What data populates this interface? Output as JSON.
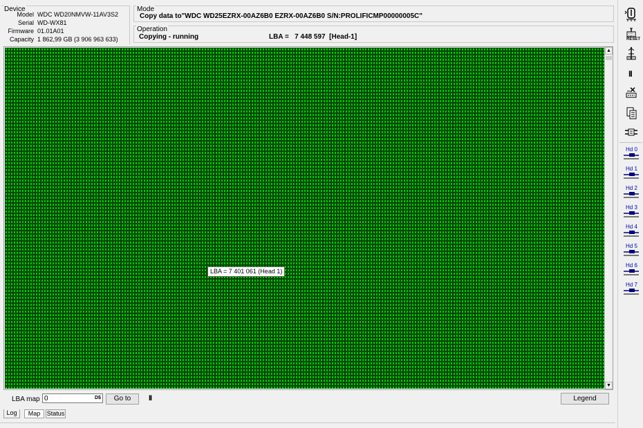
{
  "device": {
    "title": "Device",
    "rows": [
      {
        "key": "Model",
        "value": "WDC WD20NMVW-11AV3S2"
      },
      {
        "key": "Serial",
        "value": "WD-WX81"
      },
      {
        "key": "Firmware",
        "value": "01.01A01"
      },
      {
        "key": "Capacity",
        "value": "1 862,99 GB (3 906 963 633)"
      }
    ]
  },
  "mode": {
    "title": "Mode",
    "text": "Copy data to\"WDC WD25EZRX-00AZ6B0 EZRX-00AZ6B0 S/N:PROLIFICMP00000005C\""
  },
  "operation": {
    "title": "Operation",
    "status": "Copying - running",
    "lba": "LBA =   7 448 597  [Head-1]"
  },
  "map": {
    "block_color": "#00c800",
    "block_border": "#004400",
    "tooltip": "LBA =  7 401 061 (Head 1)"
  },
  "controls": {
    "lba_map_label": "LBA map",
    "lba_value": "0",
    "lba_suffix": "D$",
    "goto_label": "Go to",
    "pause_glyph": "II",
    "legend_label": "Legend"
  },
  "tabs": [
    "Log",
    "Map",
    "Status"
  ],
  "toolbar": {
    "icons": [
      "power-icon",
      "reset-icon",
      "sensor-icon",
      "pause-icon",
      "stop-icon",
      "copy-icon",
      "transfer-icon"
    ],
    "reset_label": "RESET",
    "pause_glyph": "II",
    "heads": [
      "Hd 0",
      "Hd 1",
      "Hd 2",
      "Hd 3",
      "Hd 4",
      "Hd 5",
      "Hd 6",
      "Hd 7"
    ]
  }
}
